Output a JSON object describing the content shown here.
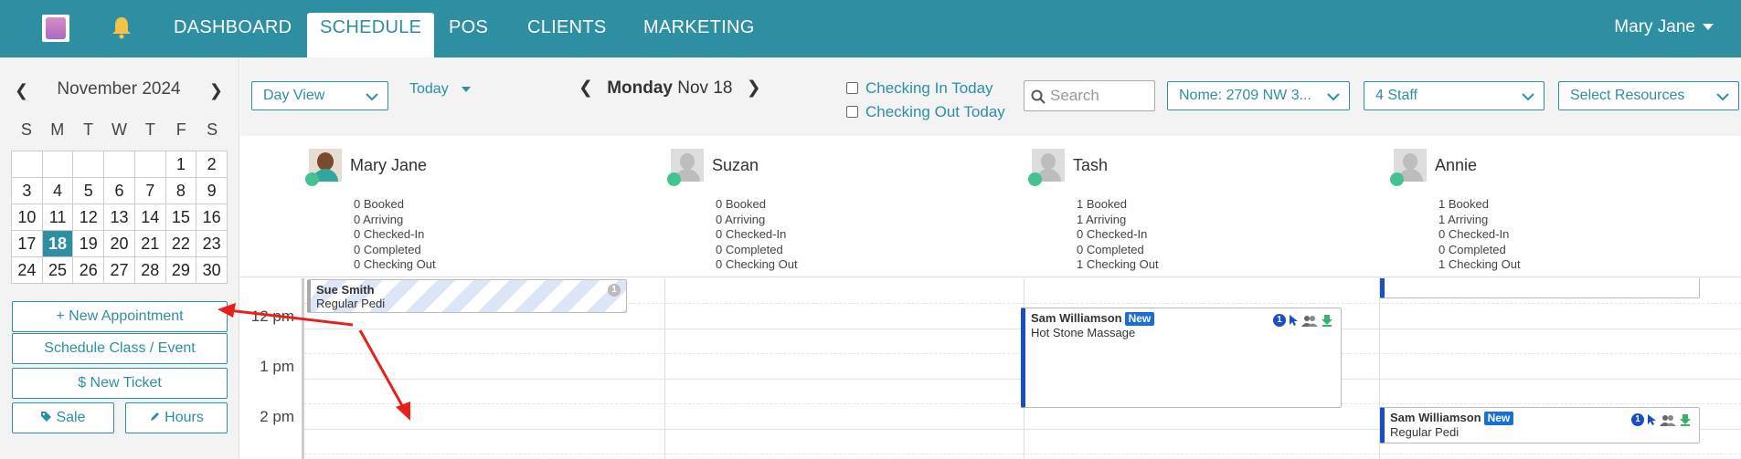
{
  "nav": {
    "items": [
      "DASHBOARD",
      "SCHEDULE",
      "POS",
      "CLIENTS",
      "MARKETING"
    ],
    "active": "SCHEDULE",
    "user": "Mary Jane"
  },
  "calendar": {
    "title": "November 2024",
    "dow": [
      "S",
      "M",
      "T",
      "W",
      "T",
      "F",
      "S"
    ],
    "weeks": [
      [
        "",
        "",
        "",
        "",
        "",
        "1",
        "2"
      ],
      [
        "3",
        "4",
        "5",
        "6",
        "7",
        "8",
        "9"
      ],
      [
        "10",
        "11",
        "12",
        "13",
        "14",
        "15",
        "16"
      ],
      [
        "17",
        "18",
        "19",
        "20",
        "21",
        "22",
        "23"
      ],
      [
        "24",
        "25",
        "26",
        "27",
        "28",
        "29",
        "30"
      ]
    ],
    "selected": "18"
  },
  "left_buttons": {
    "new_appointment": "+ New Appointment",
    "schedule_class": "Schedule Class / Event",
    "new_ticket": "$  New Ticket",
    "sale": "Sale",
    "hours": "Hours"
  },
  "toolbar": {
    "view": "Day View",
    "today": "Today",
    "date_day": "Monday",
    "date_rest": "Nov 18",
    "checking_in": "Checking In Today",
    "checking_out": "Checking Out Today",
    "search_placeholder": "Search",
    "location": "Nome: 2709 NW 3...",
    "staff": "4 Staff",
    "resources": "Select Resources"
  },
  "staff": [
    {
      "name": "Mary Jane",
      "stats": [
        "0 Booked",
        "0 Arriving",
        "0 Checked-In",
        "0 Completed",
        "0 Checking Out"
      ]
    },
    {
      "name": "Suzan",
      "stats": [
        "0 Booked",
        "0 Arriving",
        "0 Checked-In",
        "0 Completed",
        "0 Checking Out"
      ]
    },
    {
      "name": "Tash",
      "stats": [
        "1 Booked",
        "1 Arriving",
        "0 Checked-In",
        "0 Completed",
        "1 Checking Out"
      ]
    },
    {
      "name": "Annie",
      "stats": [
        "1 Booked",
        "1 Arriving",
        "0 Checked-In",
        "0 Completed",
        "1 Checking Out"
      ]
    }
  ],
  "times": [
    "12 pm",
    "1 pm",
    "2 pm"
  ],
  "appointments": [
    {
      "client": "Sue Smith",
      "service": "Regular Pedi",
      "count": "1"
    },
    {
      "client": "Sam Williamson",
      "badge": "New",
      "service": "Hot Stone Massage",
      "count": "1"
    },
    {
      "client": "Sam Williamson",
      "badge": "New",
      "service": "Regular Pedi",
      "count": "1"
    }
  ],
  "colors": {
    "brand": "#2e8fa3",
    "online": "#44c391",
    "appt_border": "#1a4fc4",
    "annotation_arrow": "#e8201c"
  }
}
